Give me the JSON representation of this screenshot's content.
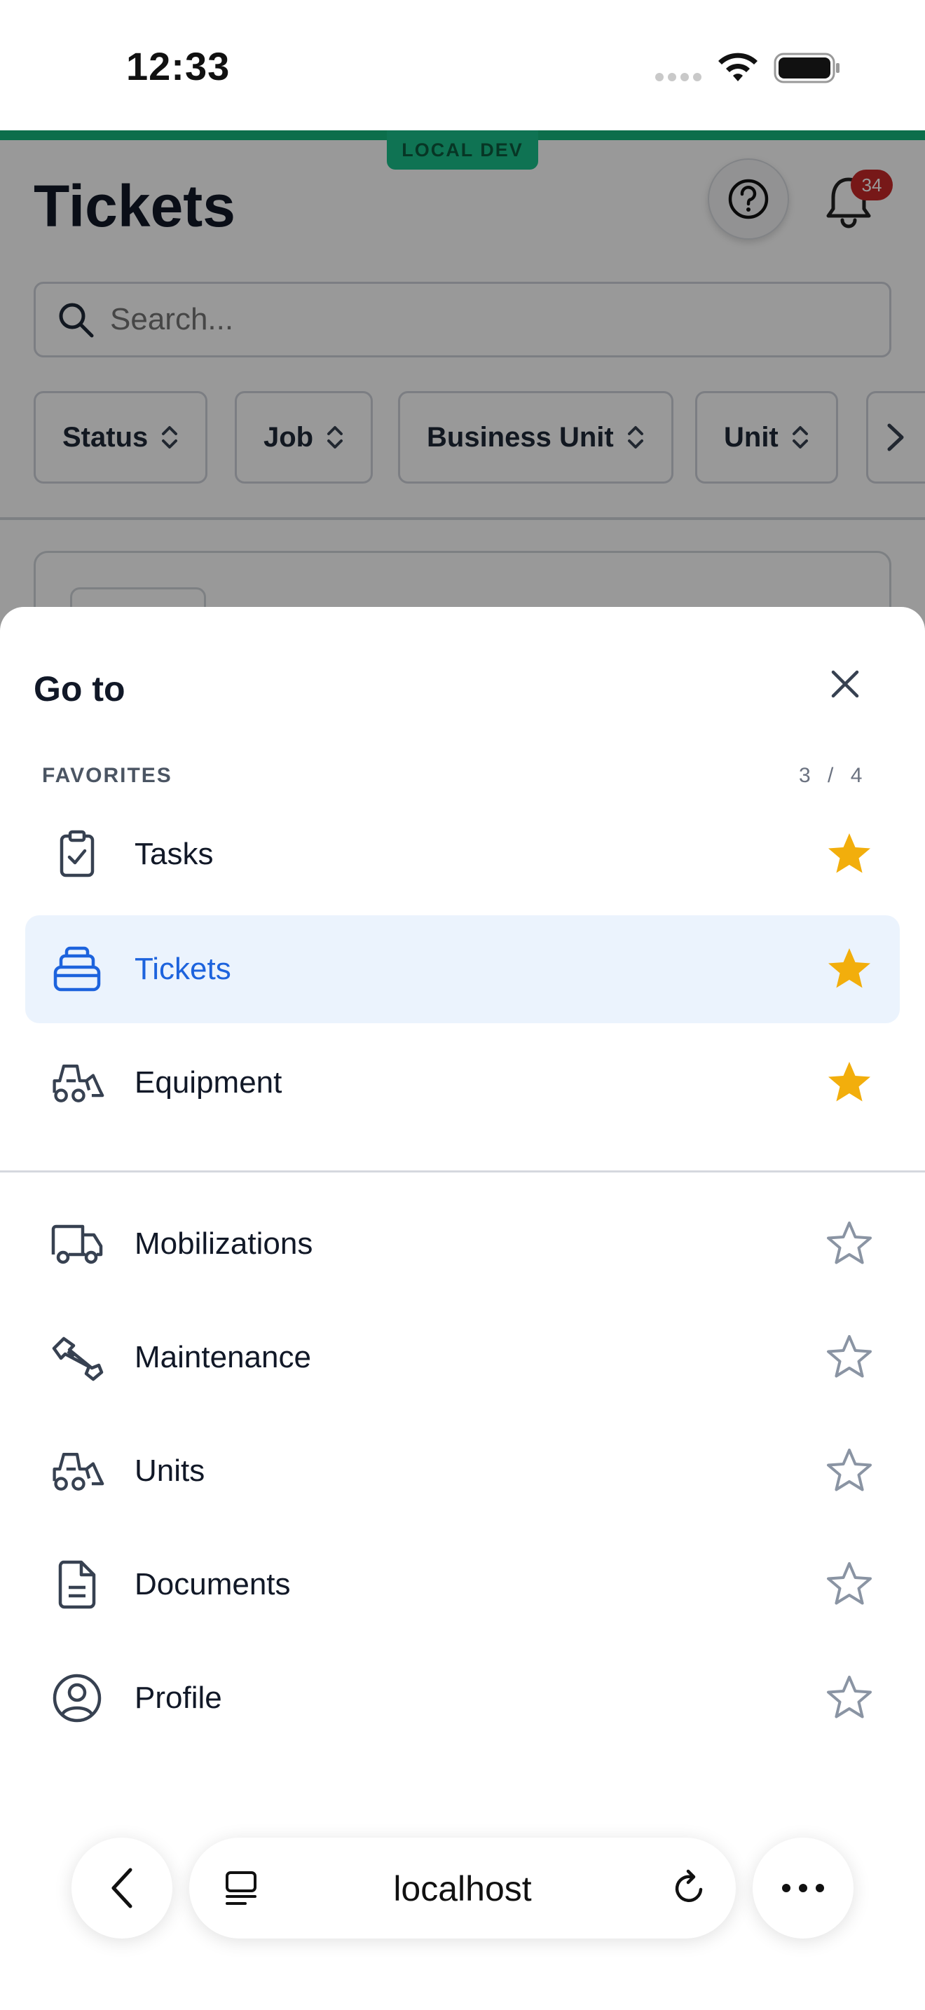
{
  "status_bar": {
    "time": "12:33"
  },
  "app": {
    "env_badge": "LOCAL DEV",
    "title": "Tickets",
    "notification_count": "34",
    "search": {
      "placeholder": "Search...",
      "value": ""
    },
    "filters": [
      {
        "label": "Status"
      },
      {
        "label": "Job"
      },
      {
        "label": "Business Unit"
      },
      {
        "label": "Unit"
      }
    ]
  },
  "sheet": {
    "title": "Go to",
    "favorites_label": "FAVORITES",
    "favorites_count": "3 / 4",
    "favorites": [
      {
        "label": "Tasks",
        "icon": "clipboard-check-icon",
        "starred": true
      },
      {
        "label": "Tickets",
        "icon": "inbox-stack-icon",
        "starred": true,
        "active": true
      },
      {
        "label": "Equipment",
        "icon": "skid-steer-icon",
        "starred": true
      }
    ],
    "others": [
      {
        "label": "Mobilizations",
        "icon": "truck-icon",
        "starred": false
      },
      {
        "label": "Maintenance",
        "icon": "wrench-icon",
        "starred": false
      },
      {
        "label": "Units",
        "icon": "skid-steer-icon",
        "starred": false
      },
      {
        "label": "Documents",
        "icon": "document-icon",
        "starred": false
      },
      {
        "label": "Profile",
        "icon": "user-circle-icon",
        "starred": false
      }
    ],
    "colors": {
      "star_filled": "#f2ae0c",
      "star_empty": "#8a94a3",
      "active_bg": "#ebf3fd",
      "active_text": "#1d63dd"
    }
  },
  "browser": {
    "host": "localhost"
  }
}
